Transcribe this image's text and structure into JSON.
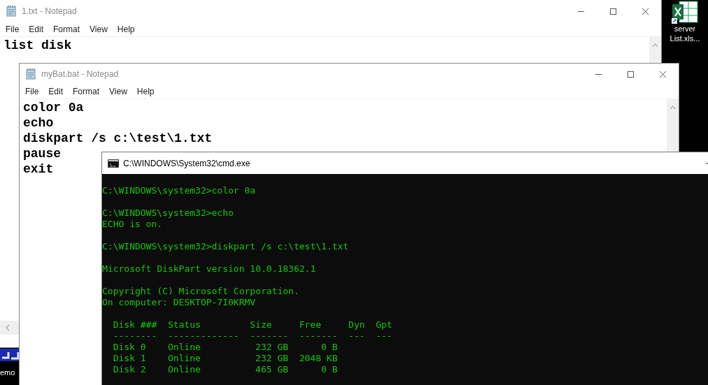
{
  "desktop": {
    "icons": [
      {
        "label_lines": [
          "server",
          "List.xls..."
        ]
      },
      {
        "label_lines": [
          "emo"
        ]
      }
    ]
  },
  "windows": [
    {
      "kind": "notepad",
      "title": "1.txt - Notepad",
      "menu": [
        "File",
        "Edit",
        "Format",
        "View",
        "Help"
      ],
      "lines": [
        "list disk"
      ]
    },
    {
      "kind": "notepad",
      "title": "myBat.bat - Notepad",
      "menu": [
        "File",
        "Edit",
        "Format",
        "View",
        "Help"
      ],
      "lines": [
        "color 0a",
        "echo",
        "diskpart /s c:\\test\\1.txt",
        "pause",
        "exit"
      ]
    },
    {
      "kind": "console",
      "title": "C:\\WINDOWS\\System32\\cmd.exe",
      "blocks": [
        {
          "kind": "text",
          "lines": [
            "C:\\WINDOWS\\system32>color 0a"
          ]
        },
        {
          "kind": "text",
          "lines": [
            "C:\\WINDOWS\\system32>echo",
            "ECHO is on."
          ]
        },
        {
          "kind": "text",
          "lines": [
            "C:\\WINDOWS\\system32>diskpart /s c:\\test\\1.txt"
          ]
        },
        {
          "kind": "text",
          "lines": [
            "Microsoft DiskPart version 10.0.18362.1"
          ]
        },
        {
          "kind": "text",
          "lines": [
            "Copyright (C) Microsoft Corporation.",
            "On computer: DESKTOP-7I0KRMV"
          ]
        },
        {
          "kind": "table",
          "header": [
            "Disk ###",
            "Status",
            "Size",
            "Free",
            "Dyn",
            "Gpt"
          ],
          "rule": [
            "--------",
            "-------------",
            "-------",
            "-------",
            "---",
            "---"
          ],
          "rows": [
            [
              "Disk 0",
              "Online",
              "232 GB",
              "0 B"
            ],
            [
              "Disk 1",
              "Online",
              "232 GB",
              "2048 KB"
            ],
            [
              "Disk 2",
              "Online",
              "465 GB",
              "0 B"
            ]
          ]
        }
      ]
    }
  ]
}
